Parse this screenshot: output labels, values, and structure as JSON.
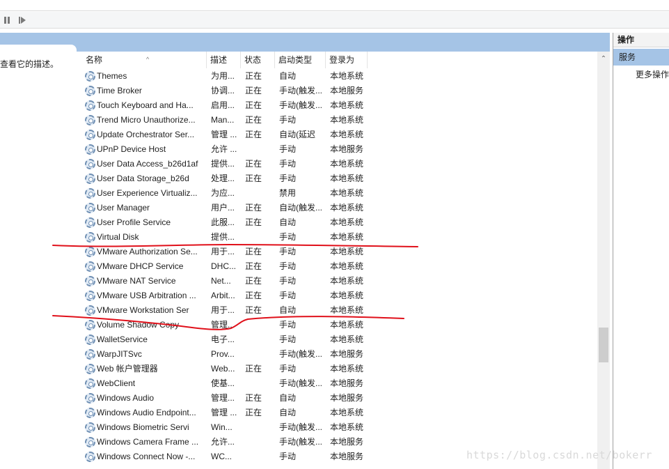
{
  "toolbar": {
    "pause_icon": "pause-icon",
    "restart_icon": "restart-icon"
  },
  "description_pane": {
    "text": "查看它的描述。"
  },
  "columns": {
    "name": "名称",
    "description": "描述",
    "status": "状态",
    "startup_type": "启动类型",
    "log_on_as": "登录为",
    "sort_glyph": "^"
  },
  "services": [
    {
      "name": "Themes",
      "description": "为用...",
      "status": "正在",
      "startup": "自动",
      "logon": "本地系统"
    },
    {
      "name": "Time Broker",
      "description": "协调...",
      "status": "正在",
      "startup": "手动(触发...",
      "logon": "本地服务"
    },
    {
      "name": "Touch Keyboard and Ha...",
      "description": "启用...",
      "status": "正在",
      "startup": "手动(触发...",
      "logon": "本地系统"
    },
    {
      "name": "Trend Micro Unauthorize...",
      "description": "Man...",
      "status": "正在",
      "startup": "手动",
      "logon": "本地系统"
    },
    {
      "name": "Update Orchestrator Ser...",
      "description": "管理 ...",
      "status": "正在",
      "startup": "自动(延迟",
      "logon": "本地系统"
    },
    {
      "name": "UPnP Device Host",
      "description": "允许 ...",
      "status": "",
      "startup": "手动",
      "logon": "本地服务"
    },
    {
      "name": "User Data Access_b26d1af",
      "description": "提供...",
      "status": "正在",
      "startup": "手动",
      "logon": "本地系统"
    },
    {
      "name": "User Data Storage_b26d",
      "description": "处理...",
      "status": "正在",
      "startup": "手动",
      "logon": "本地系统"
    },
    {
      "name": "User Experience Virtualiz...",
      "description": "为应...",
      "status": "",
      "startup": "禁用",
      "logon": "本地系统"
    },
    {
      "name": "User Manager",
      "description": "用户...",
      "status": "正在",
      "startup": "自动(触发...",
      "logon": "本地系统"
    },
    {
      "name": "User Profile Service",
      "description": "此服...",
      "status": "正在",
      "startup": "自动",
      "logon": "本地系统"
    },
    {
      "name": "Virtual Disk",
      "description": "提供...",
      "status": "",
      "startup": "手动",
      "logon": "本地系统"
    },
    {
      "name": "VMware Authorization Se...",
      "description": "用于...",
      "status": "正在",
      "startup": "手动",
      "logon": "本地系统"
    },
    {
      "name": "VMware DHCP Service",
      "description": "DHC...",
      "status": "正在",
      "startup": "手动",
      "logon": "本地系统"
    },
    {
      "name": "VMware NAT Service",
      "description": "Net...",
      "status": "正在",
      "startup": "手动",
      "logon": "本地系统"
    },
    {
      "name": "VMware USB Arbitration ...",
      "description": "Arbit...",
      "status": "正在",
      "startup": "手动",
      "logon": "本地系统"
    },
    {
      "name": "VMware Workstation Ser",
      "description": "用于...",
      "status": "正在",
      "startup": "自动",
      "logon": "本地系统"
    },
    {
      "name": "Volume Shadow Copy",
      "description": "管理...",
      "status": "",
      "startup": "手动",
      "logon": "本地系统"
    },
    {
      "name": "WalletService",
      "description": "电子...",
      "status": "",
      "startup": "手动",
      "logon": "本地系统"
    },
    {
      "name": "WarpJITSvc",
      "description": "Prov...",
      "status": "",
      "startup": "手动(触发...",
      "logon": "本地服务"
    },
    {
      "name": "Web 帐户管理器",
      "description": "Web...",
      "status": "正在",
      "startup": "手动",
      "logon": "本地系统"
    },
    {
      "name": "WebClient",
      "description": "使基...",
      "status": "",
      "startup": "手动(触发...",
      "logon": "本地服务"
    },
    {
      "name": "Windows Audio",
      "description": "管理...",
      "status": "正在",
      "startup": "自动",
      "logon": "本地服务"
    },
    {
      "name": "Windows Audio Endpoint...",
      "description": "管理 ...",
      "status": "正在",
      "startup": "自动",
      "logon": "本地系统"
    },
    {
      "name": "Windows Biometric Servi",
      "description": "Win...",
      "status": "",
      "startup": "手动(触发...",
      "logon": "本地系统"
    },
    {
      "name": "Windows Camera Frame ...",
      "description": "允许...",
      "status": "",
      "startup": "手动(触发...",
      "logon": "本地服务"
    },
    {
      "name": "Windows Connect Now -...",
      "description": "WC...",
      "status": "",
      "startup": "手动",
      "logon": "本地服务"
    }
  ],
  "service_icon": "service-gear-icon",
  "actions": {
    "title": "操作",
    "group": "服务",
    "more": "更多操作"
  },
  "annotation": {
    "color": "#e0101a"
  },
  "watermark": "https://blog.csdn.net/bokerr"
}
